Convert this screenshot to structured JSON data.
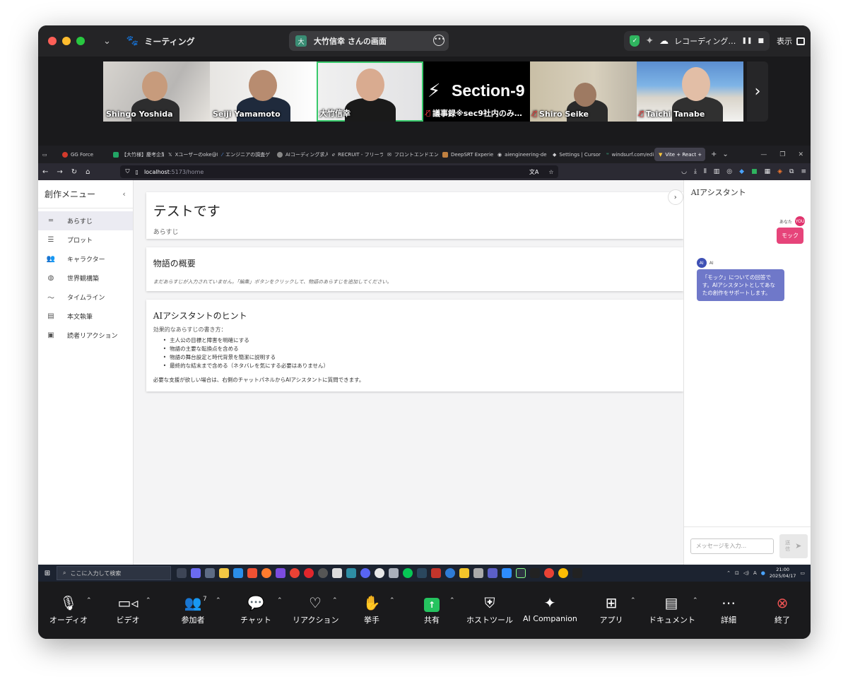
{
  "zoom": {
    "meeting_label": "ミーティング",
    "share_initial": "大",
    "share_label": "大竹信幸 さんの画面",
    "recording_label": "レコーディング…",
    "view_label": "表示"
  },
  "participants": [
    {
      "name": "Shingo Yoshida",
      "muted": false
    },
    {
      "name": "Seiji Yamamoto",
      "muted": false
    },
    {
      "name": "大竹信幸",
      "muted": false,
      "active": true
    },
    {
      "name": "議事録※sec9社内のみ…",
      "muted": true,
      "logo_text": "Section-9"
    },
    {
      "name": "Shiro Seike",
      "muted": true
    },
    {
      "name": "Taichi Tanabe",
      "muted": true
    }
  ],
  "browser": {
    "tabs": [
      {
        "label": "GG Force",
        "color": "#d33a2c"
      },
      {
        "label": "【大竹様】慶考企業",
        "color": "#22a565"
      },
      {
        "label": "Xユーザーのoke@F",
        "color": "#000000"
      },
      {
        "label": "エンジニアの調査ゲ",
        "color": "#2a6fd6"
      },
      {
        "label": "AIコーディング求人比",
        "color": "#888888"
      },
      {
        "label": "RECRUIT - フリーラン",
        "color": "#999999"
      },
      {
        "label": "フロントエンドエンジ",
        "color": "#e6e6e6"
      },
      {
        "label": "DeepSRT Experien",
        "color": "#c08040"
      },
      {
        "label": "aiengineering-de",
        "color": "#dddddd"
      },
      {
        "label": "Settings | Cursor",
        "color": "#333333"
      },
      {
        "label": "windsurf.com/edi",
        "color": "#3fb68b"
      },
      {
        "label": "Vite + React +",
        "color": "#ffc83d",
        "active": true
      }
    ],
    "url_host": "localhost",
    "url_path": ":5173/home"
  },
  "app": {
    "sidebar_title": "創作メニュー",
    "menu": [
      {
        "label": "あらすじ",
        "icon": "short-text-icon",
        "glyph": "═",
        "selected": true
      },
      {
        "label": "プロット",
        "icon": "list-icon",
        "glyph": "☰"
      },
      {
        "label": "キャラクター",
        "icon": "people-icon",
        "glyph": "👥"
      },
      {
        "label": "世界観構築",
        "icon": "globe-icon",
        "glyph": "◍"
      },
      {
        "label": "タイムライン",
        "icon": "timeline-icon",
        "glyph": "〜"
      },
      {
        "label": "本文執筆",
        "icon": "book-icon",
        "glyph": "▤"
      },
      {
        "label": "読者リアクション",
        "icon": "feedback-icon",
        "glyph": "▣"
      }
    ],
    "doc_title": "テストです",
    "doc_subtitle": "あらすじ",
    "summary_heading": "物語の概要",
    "summary_text": "まだあらすじが入力されていません。「編集」ボタンをクリックして、物語のあらすじを追加してください。",
    "hints_heading": "AIアシスタントのヒント",
    "hints_intro": "効果的なあらすじの書き方：",
    "hints": [
      "主人公の目標と障害を明確にする",
      "物語の主要な転換点を含める",
      "物語の舞台設定と時代背景を簡潔に説明する",
      "最終的な結末まで含める（ネタバレを気にする必要はありません）"
    ],
    "hints_footer": "必要な支援が欲しい場合は、右側のチャットパネルからAIアシスタントに質問できます。"
  },
  "chat": {
    "title": "AIアシスタント",
    "me_label": "あなた",
    "me_avatar": "YOU",
    "me_message": "モック",
    "ai_label": "AI",
    "ai_avatar": "AI",
    "ai_message": "「モック」についての回答です。AIアシスタントとしてあなたの創作をサポートします。",
    "input_placeholder": "メッセージを入力...",
    "send_label": "送信"
  },
  "taskbar": {
    "search_placeholder": "ここに入力して検索",
    "time": "21:00",
    "date": "2025/04/17",
    "ime": "A"
  },
  "toolbar": {
    "audio": "オーディオ",
    "video": "ビデオ",
    "participants": "参加者",
    "participants_count": "7",
    "chat": "チャット",
    "reaction": "リアクション",
    "raise_hand": "挙手",
    "share": "共有",
    "host_tools": "ホストツール",
    "ai_companion": "AI Companion",
    "apps": "アプリ",
    "docs": "ドキュメント",
    "more": "詳細",
    "end": "終了"
  }
}
